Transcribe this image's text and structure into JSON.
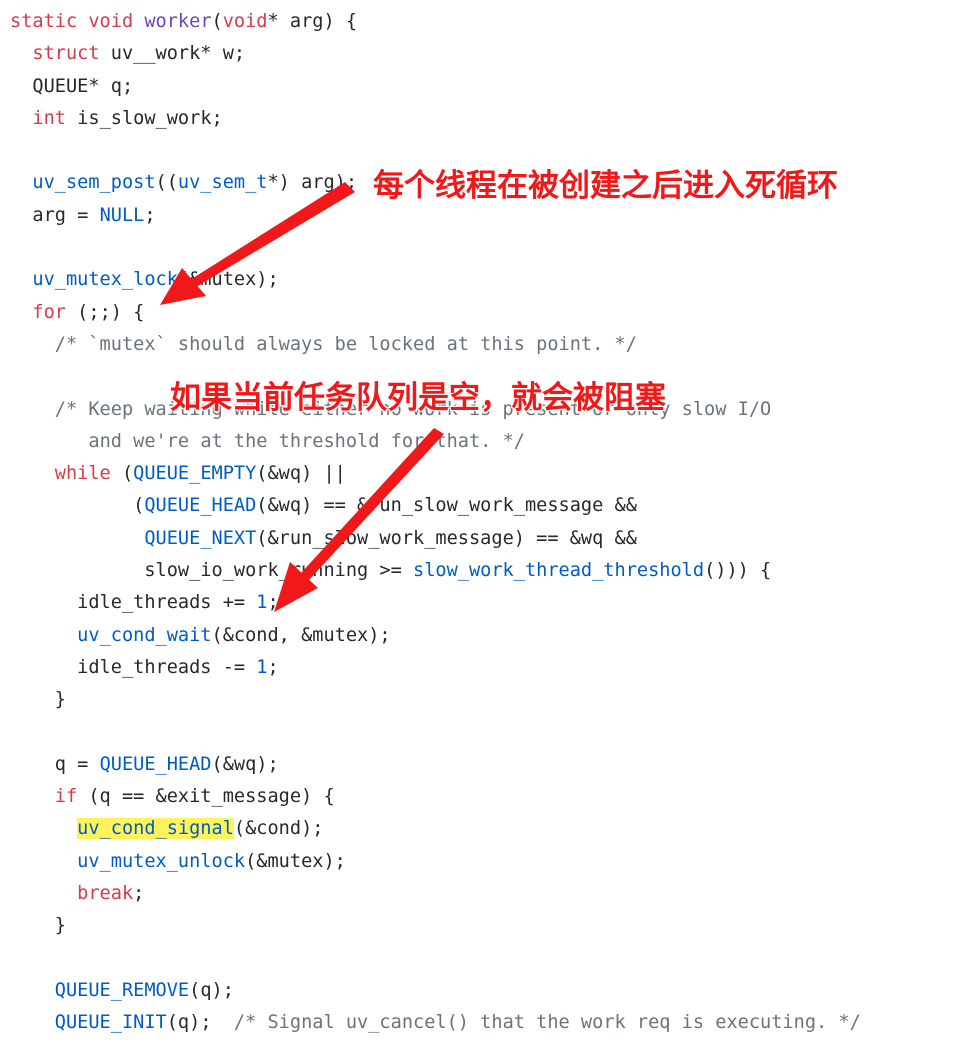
{
  "code_lines": [
    [
      {
        "t": "static void ",
        "c": "kw"
      },
      {
        "t": "worker",
        "c": "fn"
      },
      {
        "t": "(",
        "c": ""
      },
      {
        "t": "void",
        "c": "kw"
      },
      {
        "t": "* arg) {",
        "c": ""
      }
    ],
    [
      {
        "t": "  ",
        "c": ""
      },
      {
        "t": "struct",
        "c": "kw"
      },
      {
        "t": " uv__work* w;",
        "c": ""
      }
    ],
    [
      {
        "t": "  QUEUE* q;",
        "c": ""
      }
    ],
    [
      {
        "t": "  ",
        "c": ""
      },
      {
        "t": "int",
        "c": "kw"
      },
      {
        "t": " is_slow_work;",
        "c": ""
      }
    ],
    [
      {
        "t": "",
        "c": ""
      }
    ],
    [
      {
        "t": "  ",
        "c": ""
      },
      {
        "t": "uv_sem_post",
        "c": "call"
      },
      {
        "t": "((",
        "c": ""
      },
      {
        "t": "uv_sem_t",
        "c": "call"
      },
      {
        "t": "*) arg);",
        "c": ""
      }
    ],
    [
      {
        "t": "  arg = ",
        "c": ""
      },
      {
        "t": "NULL",
        "c": "call"
      },
      {
        "t": ";",
        "c": ""
      }
    ],
    [
      {
        "t": "",
        "c": ""
      }
    ],
    [
      {
        "t": "  ",
        "c": ""
      },
      {
        "t": "uv_mutex_lock",
        "c": "call"
      },
      {
        "t": "(&mutex);",
        "c": ""
      }
    ],
    [
      {
        "t": "  ",
        "c": ""
      },
      {
        "t": "for",
        "c": "kw"
      },
      {
        "t": " (;;) {",
        "c": ""
      }
    ],
    [
      {
        "t": "    ",
        "c": ""
      },
      {
        "t": "/* `mutex` should always be locked at this point. */",
        "c": "cm"
      }
    ],
    [
      {
        "t": "",
        "c": ""
      }
    ],
    [
      {
        "t": "    ",
        "c": ""
      },
      {
        "t": "/* Keep waiting while either no work is present or only slow I/O",
        "c": "cm"
      }
    ],
    [
      {
        "t": "       ",
        "c": ""
      },
      {
        "t": "and we're at the threshold for that. */",
        "c": "cm"
      }
    ],
    [
      {
        "t": "    ",
        "c": ""
      },
      {
        "t": "while",
        "c": "kw"
      },
      {
        "t": " (",
        "c": ""
      },
      {
        "t": "QUEUE_EMPTY",
        "c": "call"
      },
      {
        "t": "(&wq) ||",
        "c": ""
      }
    ],
    [
      {
        "t": "           (",
        "c": ""
      },
      {
        "t": "QUEUE_HEAD",
        "c": "call"
      },
      {
        "t": "(&wq) == &run_slow_work_message &&",
        "c": ""
      }
    ],
    [
      {
        "t": "            ",
        "c": ""
      },
      {
        "t": "QUEUE_NEXT",
        "c": "call"
      },
      {
        "t": "(&run_slow_work_message) == &wq &&",
        "c": ""
      }
    ],
    [
      {
        "t": "            slow_io_work_running >= ",
        "c": ""
      },
      {
        "t": "slow_work_thread_threshold",
        "c": "call"
      },
      {
        "t": "())) {",
        "c": ""
      }
    ],
    [
      {
        "t": "      idle_threads += ",
        "c": ""
      },
      {
        "t": "1",
        "c": "num"
      },
      {
        "t": ";",
        "c": ""
      }
    ],
    [
      {
        "t": "      ",
        "c": ""
      },
      {
        "t": "uv_cond_wait",
        "c": "call"
      },
      {
        "t": "(&cond, &mutex);",
        "c": ""
      }
    ],
    [
      {
        "t": "      idle_threads -= ",
        "c": ""
      },
      {
        "t": "1",
        "c": "num"
      },
      {
        "t": ";",
        "c": ""
      }
    ],
    [
      {
        "t": "    }",
        "c": ""
      }
    ],
    [
      {
        "t": "",
        "c": ""
      }
    ],
    [
      {
        "t": "    q = ",
        "c": ""
      },
      {
        "t": "QUEUE_HEAD",
        "c": "call"
      },
      {
        "t": "(&wq);",
        "c": ""
      }
    ],
    [
      {
        "t": "    ",
        "c": ""
      },
      {
        "t": "if",
        "c": "kw"
      },
      {
        "t": " (q == &exit_message) {",
        "c": ""
      }
    ],
    [
      {
        "t": "      ",
        "c": ""
      },
      {
        "t": "uv_cond_signal",
        "c": "hl"
      },
      {
        "t": "(&cond);",
        "c": ""
      }
    ],
    [
      {
        "t": "      ",
        "c": ""
      },
      {
        "t": "uv_mutex_unlock",
        "c": "call"
      },
      {
        "t": "(&mutex);",
        "c": ""
      }
    ],
    [
      {
        "t": "      ",
        "c": ""
      },
      {
        "t": "break",
        "c": "kw"
      },
      {
        "t": ";",
        "c": ""
      }
    ],
    [
      {
        "t": "    }",
        "c": ""
      }
    ],
    [
      {
        "t": "",
        "c": ""
      }
    ],
    [
      {
        "t": "    ",
        "c": ""
      },
      {
        "t": "QUEUE_REMOVE",
        "c": "call"
      },
      {
        "t": "(q);",
        "c": ""
      }
    ],
    [
      {
        "t": "    ",
        "c": ""
      },
      {
        "t": "QUEUE_INIT",
        "c": "call"
      },
      {
        "t": "(q);  ",
        "c": ""
      },
      {
        "t": "/* Signal uv_cancel() that the work req is executing. */",
        "c": "cm"
      }
    ]
  ],
  "annotations": {
    "first": "每个线程在被创建之后进入死循环",
    "second": "如果当前任务队列是空，就会被阻塞"
  },
  "colors": {
    "arrow": "#f01818",
    "highlight": "#fff35a"
  }
}
